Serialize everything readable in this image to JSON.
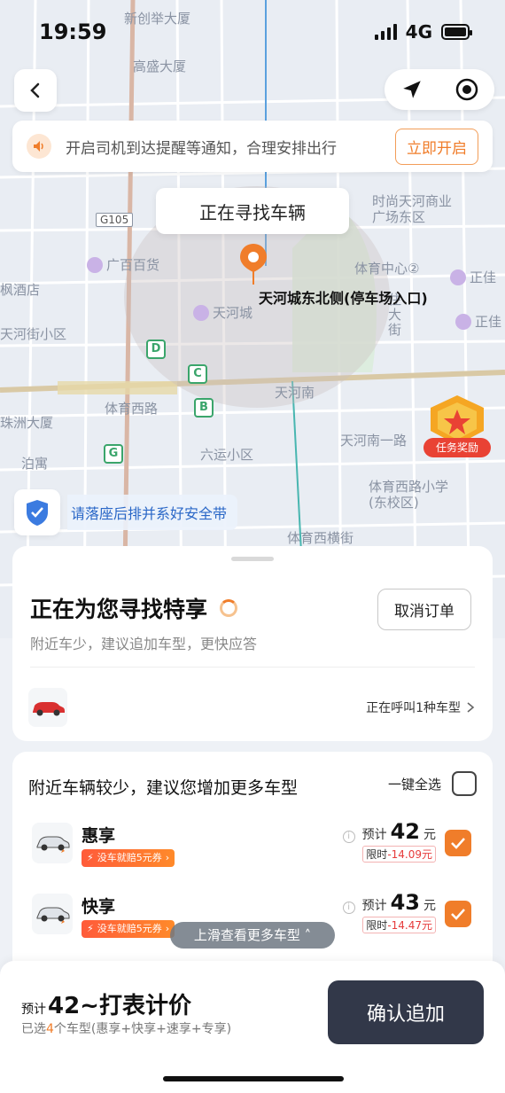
{
  "status_bar": {
    "time": "19:59",
    "network": "4G"
  },
  "map": {
    "labels": {
      "xinchuang": "新创举大厦",
      "gaosheng": "高盛大厦",
      "shidai": "时尚天河商业广场东区",
      "guangbai": "广百百货",
      "tiyu_zhongxin": "体育中心②",
      "zhengjia_1": "正佳",
      "zhengjia_2": "正佳",
      "fengjiu": "枫酒店",
      "tianhecheng": "天河城",
      "tianhejie": "天河街小区",
      "tianhenan": "天河南",
      "tianhenan_yilu": "天河南一路",
      "tiyuxilu": "体育西路",
      "zhouhai": "珠洲大厦",
      "liuyun": "六运小区",
      "bohai": "泊寓",
      "tiyuxilu_school": "体育西路小学(东校区)",
      "tiyuxi_hengjie": "体育西横街",
      "zhuyuan": "住大街",
      "g105": "G105"
    },
    "metro_labels": [
      "D",
      "C",
      "B",
      "G"
    ],
    "pickup_label": "天河城东北侧(停车场入口)",
    "searching_pill": "正在寻找车辆"
  },
  "notice": {
    "text": "开启司机到达提醒等通知，合理安排出行",
    "button": "立即开启"
  },
  "reward": {
    "label": "任务奖励"
  },
  "seatbelt": {
    "text": "请落座后排并系好安全带"
  },
  "main_card": {
    "title": "正在为您寻找特享",
    "subtitle": "附近车少，建议追加车型，更快应答",
    "cancel": "取消订单",
    "calling": "正在呼叫1种车型"
  },
  "suggest": {
    "title": "附近车辆较少，建议您增加更多车型",
    "select_all": "一键全选",
    "cars": [
      {
        "name": "惠享",
        "coupon": "没车就赔5元券",
        "price_label": "预计",
        "price": "42",
        "unit": "元",
        "limited_label": "限时",
        "limited_value": "-14.09元",
        "checked": true
      },
      {
        "name": "快享",
        "coupon": "没车就赔5元券",
        "price_label": "预计",
        "price": "43",
        "unit": "元",
        "limited_label": "限时",
        "limited_value": "-14.47元",
        "checked": true
      }
    ],
    "swipe_hint": "上滑查看更多车型"
  },
  "bottom": {
    "est_label": "预计",
    "est_value": "42~打表计价",
    "selected_prefix": "已选",
    "selected_count": "4",
    "selected_suffix": "个车型(惠享+快享+速享+专享)",
    "confirm": "确认追加"
  },
  "colors": {
    "accent": "#f07d2a",
    "confirm_bg": "#323849",
    "seatbelt_text": "#2a67c7"
  }
}
